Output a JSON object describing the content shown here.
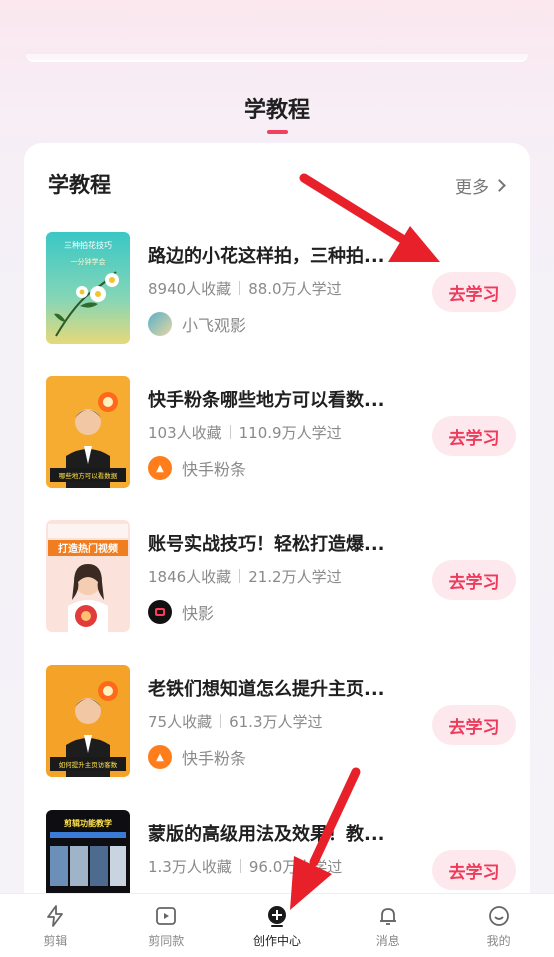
{
  "page": {
    "section_title": "学教程"
  },
  "card": {
    "title": "学教程",
    "more_label": "更多"
  },
  "tutorials": [
    {
      "title": "路边的小花这样拍，三种拍...",
      "saves": "8940人收藏",
      "learners": "88.0万人学过",
      "author": "小飞观影",
      "button": "去学习",
      "thumb_text": "三种拍花技巧 · 一分钟学会"
    },
    {
      "title": "快手粉条哪些地方可以看数...",
      "saves": "103人收藏",
      "learners": "110.9万人学过",
      "author": "快手粉条",
      "button": "去学习",
      "thumb_text": "哪些地方可以看数据"
    },
    {
      "title": "账号实战技巧！轻松打造爆...",
      "saves": "1846人收藏",
      "learners": "21.2万人学过",
      "author": "快影",
      "button": "去学习",
      "thumb_text": "打造热门视频"
    },
    {
      "title": "老铁们想知道怎么提升主页...",
      "saves": "75人收藏",
      "learners": "61.3万人学过",
      "author": "快手粉条",
      "button": "去学习",
      "thumb_text": "如何提升主页访客数"
    },
    {
      "title": "蒙版的高级用法及效果！教...",
      "saves": "1.3万人收藏",
      "learners": "96.0万人学过",
      "author": "",
      "button": "去学习",
      "thumb_text": "剪辑功能教学"
    }
  ],
  "tabbar": {
    "items": [
      {
        "label": "剪辑",
        "icon": "lightning-icon"
      },
      {
        "label": "剪同款",
        "icon": "play-icon"
      },
      {
        "label": "创作中心",
        "icon": "create-icon"
      },
      {
        "label": "消息",
        "icon": "bell-icon"
      },
      {
        "label": "我的",
        "icon": "smile-icon"
      }
    ]
  },
  "colors": {
    "accent": "#ee3b5b",
    "button_bg": "#fde8ee",
    "arrow": "#e8202a"
  }
}
